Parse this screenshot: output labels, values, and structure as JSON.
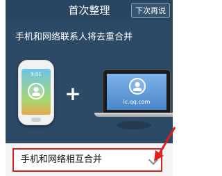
{
  "header": {
    "title": "首次整理",
    "skip_button": "下次再说"
  },
  "subtitle": "手机和网络联系人将去重合并",
  "illustration": {
    "phone_icon": "smartphone-icon",
    "phone_clock": "9:01",
    "plus": "+",
    "laptop_icon": "laptop-icon",
    "laptop_url": "ic.qq.com"
  },
  "option": {
    "label": "手机和网络相互合并",
    "icon": "chevron-down-icon"
  },
  "colors": {
    "background": "#2c4a66",
    "highlight": "#e01e1e"
  }
}
